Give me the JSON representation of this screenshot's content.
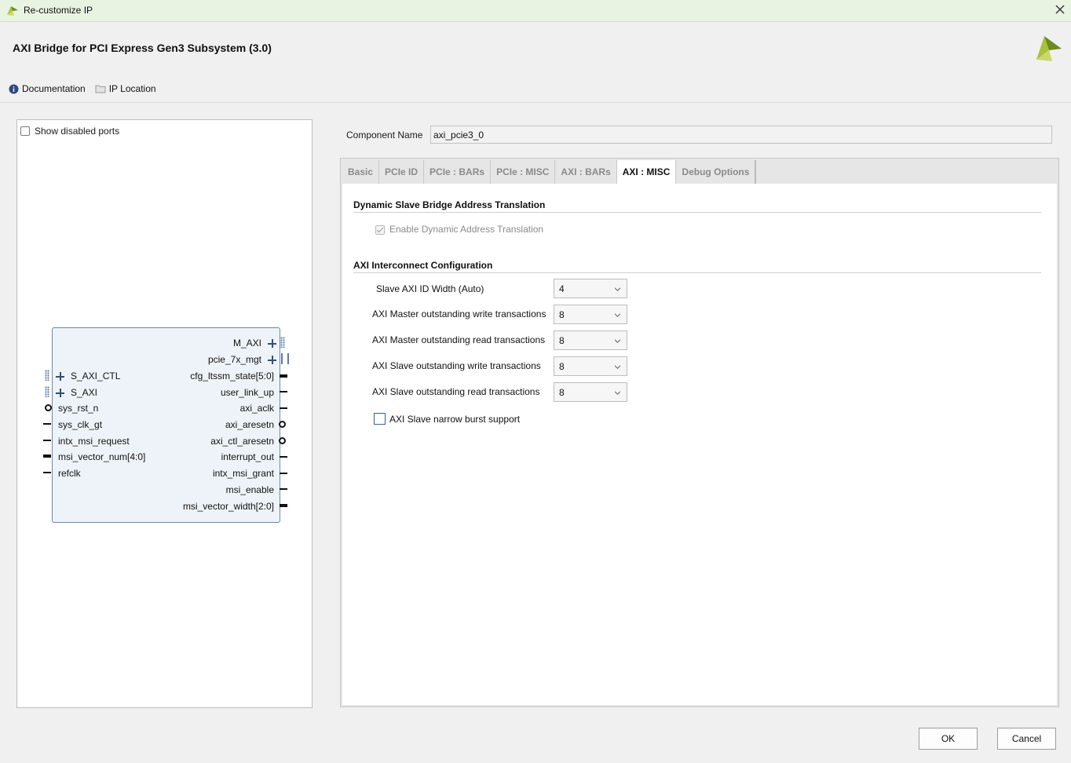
{
  "window": {
    "title": "Re-customize IP"
  },
  "header": {
    "title": "AXI Bridge for PCI Express Gen3 Subsystem (3.0)"
  },
  "links": {
    "documentation": "Documentation",
    "ip_location": "IP Location"
  },
  "left": {
    "show_disabled_ports": "Show disabled ports",
    "show_disabled_checked": false,
    "left_ports": [
      "S_AXI_CTL",
      "S_AXI",
      "sys_rst_n",
      "sys_clk_gt",
      "intx_msi_request",
      "msi_vector_num[4:0]",
      "refclk"
    ],
    "right_ports": [
      "M_AXI",
      "pcie_7x_mgt",
      "cfg_ltssm_state[5:0]",
      "user_link_up",
      "axi_aclk",
      "axi_aresetn",
      "axi_ctl_aresetn",
      "interrupt_out",
      "intx_msi_grant",
      "msi_enable",
      "msi_vector_width[2:0]"
    ]
  },
  "component": {
    "label": "Component Name",
    "value": "axi_pcie3_0"
  },
  "tabs": [
    "Basic",
    "PCIe ID",
    "PCIe : BARs",
    "PCIe : MISC",
    "AXI : BARs",
    "AXI : MISC",
    "Debug Options"
  ],
  "active_tab": "AXI : MISC",
  "sections": {
    "dynamic": {
      "title": "Dynamic Slave Bridge Address Translation",
      "enable_label": "Enable Dynamic Address Translation",
      "enable_checked": true,
      "enable_disabled": true
    },
    "interconnect": {
      "title": "AXI Interconnect Configuration",
      "rows": [
        {
          "label": "Slave AXI ID Width (Auto)",
          "value": "4"
        },
        {
          "label": "AXI Master outstanding write transactions",
          "value": "8"
        },
        {
          "label": "AXI Master outstanding read transactions",
          "value": "8"
        },
        {
          "label": "AXI Slave outstanding write transactions",
          "value": "8"
        },
        {
          "label": "AXI Slave outstanding read transactions",
          "value": "8"
        }
      ],
      "narrow_burst_label": "AXI Slave narrow burst support",
      "narrow_burst_checked": false
    }
  },
  "buttons": {
    "ok": "OK",
    "cancel": "Cancel"
  },
  "colors": {
    "accent": "#3c5d9c",
    "title_bar": "#e9f3e1",
    "block_fill": "#eef3f9",
    "logo_green": "#a8c23a"
  }
}
